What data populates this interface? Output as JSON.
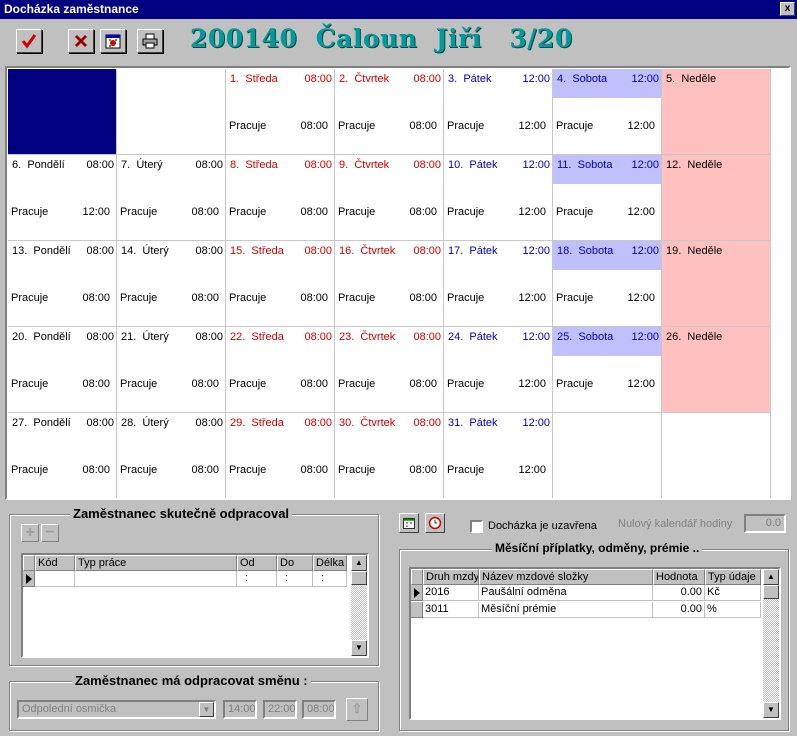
{
  "window": {
    "title": "Docházka zaměstnance",
    "close_label": "x"
  },
  "toolbar": {
    "buttons": [
      {
        "name": "confirm-check-icon"
      },
      {
        "name": "cancel-x-icon"
      },
      {
        "name": "calendar-icon"
      },
      {
        "name": "print-icon"
      }
    ]
  },
  "employee_header": "200140  Čaloun  Jiří   3/20",
  "calendar": {
    "weeks": [
      [
        {
          "empty": true,
          "first": true
        },
        {
          "empty": true
        },
        {
          "day": "1.",
          "name": "Středa",
          "hours": "08:00",
          "status": "Pracuje",
          "shift": "08:00",
          "color": "red"
        },
        {
          "day": "2.",
          "name": "Čtvrtek",
          "hours": "08:00",
          "status": "Pracuje",
          "shift": "08:00",
          "color": "red"
        },
        {
          "day": "3.",
          "name": "Pátek",
          "hours": "12:00",
          "status": "Pracuje",
          "shift": "12:00",
          "color": "blue"
        },
        {
          "day": "4.",
          "name": "Sobota",
          "hours": "12:00",
          "status": "Pracuje",
          "shift": "12:00",
          "color": "blue",
          "sat": true
        },
        {
          "day": "5.",
          "name": "Neděle",
          "hours": "",
          "status": "",
          "shift": "",
          "color": "black",
          "sun": true
        }
      ],
      [
        {
          "day": "6.",
          "name": "Pondělí",
          "hours": "08:00",
          "status": "Pracuje",
          "shift": "12:00",
          "color": "black"
        },
        {
          "day": "7.",
          "name": "Úterý",
          "hours": "08:00",
          "status": "Pracuje",
          "shift": "08:00",
          "color": "black"
        },
        {
          "day": "8.",
          "name": "Středa",
          "hours": "08:00",
          "status": "Pracuje",
          "shift": "08:00",
          "color": "red"
        },
        {
          "day": "9.",
          "name": "Čtvrtek",
          "hours": "08:00",
          "status": "Pracuje",
          "shift": "08:00",
          "color": "red"
        },
        {
          "day": "10.",
          "name": "Pátek",
          "hours": "12:00",
          "status": "Pracuje",
          "shift": "12:00",
          "color": "blue"
        },
        {
          "day": "11.",
          "name": "Sobota",
          "hours": "12:00",
          "status": "Pracuje",
          "shift": "12:00",
          "color": "blue",
          "sat": true
        },
        {
          "day": "12.",
          "name": "Neděle",
          "hours": "",
          "status": "",
          "shift": "",
          "color": "black",
          "sun": true
        }
      ],
      [
        {
          "day": "13.",
          "name": "Pondělí",
          "hours": "08:00",
          "status": "Pracuje",
          "shift": "08:00",
          "color": "black"
        },
        {
          "day": "14.",
          "name": "Úterý",
          "hours": "08:00",
          "status": "Pracuje",
          "shift": "08:00",
          "color": "black"
        },
        {
          "day": "15.",
          "name": "Středa",
          "hours": "08:00",
          "status": "Pracuje",
          "shift": "08:00",
          "color": "red"
        },
        {
          "day": "16.",
          "name": "Čtvrtek",
          "hours": "08:00",
          "status": "Pracuje",
          "shift": "08:00",
          "color": "red"
        },
        {
          "day": "17.",
          "name": "Pátek",
          "hours": "12:00",
          "status": "Pracuje",
          "shift": "12:00",
          "color": "blue"
        },
        {
          "day": "18.",
          "name": "Sobota",
          "hours": "12:00",
          "status": "Pracuje",
          "shift": "12:00",
          "color": "blue",
          "sat": true
        },
        {
          "day": "19.",
          "name": "Neděle",
          "hours": "",
          "status": "",
          "shift": "",
          "color": "black",
          "sun": true
        }
      ],
      [
        {
          "day": "20.",
          "name": "Pondělí",
          "hours": "08:00",
          "status": "Pracuje",
          "shift": "08:00",
          "color": "black"
        },
        {
          "day": "21.",
          "name": "Úterý",
          "hours": "08:00",
          "status": "Pracuje",
          "shift": "08:00",
          "color": "black"
        },
        {
          "day": "22.",
          "name": "Středa",
          "hours": "08:00",
          "status": "Pracuje",
          "shift": "08:00",
          "color": "red"
        },
        {
          "day": "23.",
          "name": "Čtvrtek",
          "hours": "08:00",
          "status": "Pracuje",
          "shift": "08:00",
          "color": "red"
        },
        {
          "day": "24.",
          "name": "Pátek",
          "hours": "12:00",
          "status": "Pracuje",
          "shift": "12:00",
          "color": "blue"
        },
        {
          "day": "25.",
          "name": "Sobota",
          "hours": "12:00",
          "status": "Pracuje",
          "shift": "12:00",
          "color": "blue",
          "sat": true
        },
        {
          "day": "26.",
          "name": "Neděle",
          "hours": "",
          "status": "",
          "shift": "",
          "color": "black",
          "sun": true
        }
      ],
      [
        {
          "day": "27.",
          "name": "Pondělí",
          "hours": "08:00",
          "status": "Pracuje",
          "shift": "08:00",
          "color": "black"
        },
        {
          "day": "28.",
          "name": "Úterý",
          "hours": "08:00",
          "status": "Pracuje",
          "shift": "08:00",
          "color": "black"
        },
        {
          "day": "29.",
          "name": "Středa",
          "hours": "08:00",
          "status": "Pracuje",
          "shift": "08:00",
          "color": "red"
        },
        {
          "day": "30.",
          "name": "Čtvrtek",
          "hours": "08:00",
          "status": "Pracuje",
          "shift": "08:00",
          "color": "red"
        },
        {
          "day": "31.",
          "name": "Pátek",
          "hours": "12:00",
          "status": "Pracuje",
          "shift": "12:00",
          "color": "blue"
        },
        {
          "empty": true
        },
        {
          "empty": true
        }
      ]
    ]
  },
  "worked": {
    "title": "Zaměstnanec skutečně odpracoval",
    "add_label": "+",
    "remove_label": "−",
    "columns": [
      "",
      "Kód",
      "Typ práce",
      "Od",
      "Do",
      "Délka"
    ],
    "row": [
      "",
      "",
      "",
      ":",
      ":",
      ":"
    ]
  },
  "shift": {
    "title": "Zaměstnanec má odpracovat směnu :",
    "select_value": "Odpolední osmička",
    "from": "14:00",
    "to": "22:00",
    "length": "08:00"
  },
  "attendance": {
    "closed_label": "Docházka je uzavřena",
    "zero_calendar_label": "Nulový kalendář hodiny",
    "zero_calendar_value": "0.0"
  },
  "bonuses": {
    "title": "Měsíční příplatky, odměny, prémie ..",
    "columns": [
      "",
      "Druh mzdy",
      "Název mzdové složky",
      "Hodnota",
      "Typ údaje"
    ],
    "rows": [
      [
        "",
        "2016",
        "Paušální odměna",
        "0.00",
        "Kč"
      ],
      [
        "",
        "3011",
        "Měsíční prémie",
        "0.00",
        "%"
      ]
    ]
  }
}
